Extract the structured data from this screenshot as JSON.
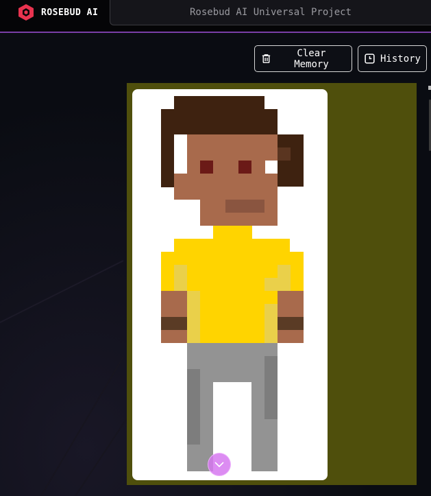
{
  "header": {
    "brand": "ROSEBUD AI",
    "project_title": "Rosebud AI Universal Project"
  },
  "toolbar": {
    "clear_memory_label": "Clear Memory",
    "history_label": "History"
  },
  "colors": {
    "accent_purple": "#7a3fa8",
    "brand_red": "#e8334f",
    "panel_olive": "#4f4f0c",
    "scroll_button": "#d678f0",
    "skin": "#a86a4c",
    "hair": "#3e2210",
    "shirt": "#ffd400",
    "pants": "#939393"
  },
  "icons": {
    "brand": "rosebud-logo-icon",
    "clear_memory": "trash-icon",
    "history": "clock-icon",
    "scroll": "chevron-down-icon"
  }
}
